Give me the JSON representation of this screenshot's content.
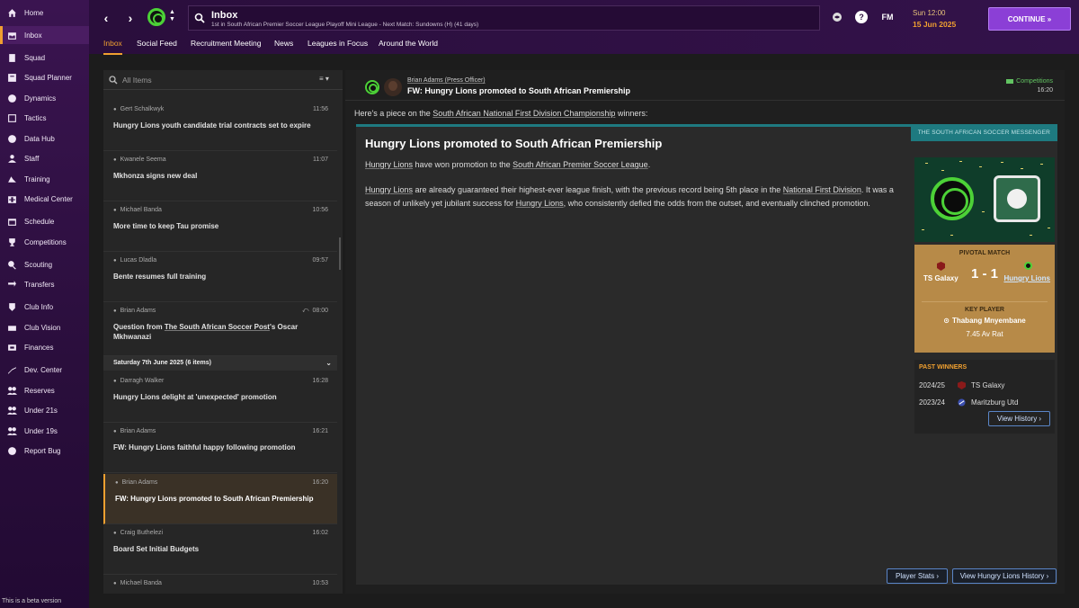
{
  "sidebar": {
    "items": [
      {
        "label": "Home",
        "icon": "home-icon"
      },
      {
        "label": "Inbox",
        "icon": "inbox-icon"
      },
      {
        "label": "Squad",
        "icon": "squad-icon"
      },
      {
        "label": "Squad Planner",
        "icon": "squad-planner-icon"
      },
      {
        "label": "Dynamics",
        "icon": "dynamics-icon"
      },
      {
        "label": "Tactics",
        "icon": "tactics-icon"
      },
      {
        "label": "Data Hub",
        "icon": "data-hub-icon"
      },
      {
        "label": "Staff",
        "icon": "staff-icon"
      },
      {
        "label": "Training",
        "icon": "training-icon"
      },
      {
        "label": "Medical Center",
        "icon": "medical-icon"
      },
      {
        "label": "Schedule",
        "icon": "schedule-icon"
      },
      {
        "label": "Competitions",
        "icon": "trophy-icon"
      },
      {
        "label": "Scouting",
        "icon": "scouting-icon"
      },
      {
        "label": "Transfers",
        "icon": "transfers-icon"
      },
      {
        "label": "Club Info",
        "icon": "club-info-icon"
      },
      {
        "label": "Club Vision",
        "icon": "club-vision-icon"
      },
      {
        "label": "Finances",
        "icon": "finances-icon"
      },
      {
        "label": "Dev. Center",
        "icon": "dev-center-icon"
      },
      {
        "label": "Reserves",
        "icon": "reserves-icon"
      },
      {
        "label": "Under 21s",
        "icon": "under21-icon"
      },
      {
        "label": "Under 19s",
        "icon": "under19-icon"
      },
      {
        "label": "Report Bug",
        "icon": "report-bug-icon"
      }
    ],
    "beta_note": "This is a beta version"
  },
  "topbar": {
    "title": "Inbox",
    "subtitle": "1st in South African Premier Soccer League Playoff Mini League - Next Match: Sundowns (H) (41 days)",
    "fm_label": "FM",
    "time": "Sun 12:00",
    "date": "15 Jun 2025",
    "continue_label": "CONTINUE  »",
    "accent": "#f0a030"
  },
  "tabs": [
    "Inbox",
    "Social Feed",
    "Recruitment Meeting",
    "News",
    "Leagues in Focus",
    "Around the World"
  ],
  "list": {
    "filter_label": "All Items",
    "view_toggle": "≡ ▾",
    "date_group": "Saturday 7th June 2025 (6 items)",
    "messages": [
      {
        "sender": "Gert Schalkwyk",
        "time": "11:56",
        "subject": "Hungry Lions youth candidate trial contracts set to expire"
      },
      {
        "sender": "Kwanele Seema",
        "time": "11:07",
        "subject": "Mkhonza signs new deal"
      },
      {
        "sender": "Michael Banda",
        "time": "10:56",
        "subject": "More time to keep Tau promise"
      },
      {
        "sender": "Lucas Dladla",
        "time": "09:57",
        "subject": "Bente resumes full training"
      },
      {
        "sender": "Brian Adams",
        "time": "08:00",
        "subject_pre": "Question from ",
        "subject_link": "The South African Soccer Post",
        "subject_post": "'s Oscar Mkhwanazi"
      },
      {
        "sender": "Darragh Walker",
        "time": "16:28",
        "subject": "Hungry Lions delight at 'unexpected' promotion"
      },
      {
        "sender": "Brian Adams",
        "time": "16:21",
        "subject": "FW: Hungry Lions faithful happy following promotion"
      },
      {
        "sender": "Brian Adams",
        "time": "16:20",
        "subject": "FW: Hungry Lions promoted to South African Premiership"
      },
      {
        "sender": "Craig Buthelezi",
        "time": "16:02",
        "subject": "Board Set Initial Budgets"
      },
      {
        "sender": "Michael Banda",
        "time": "10:53",
        "subject": ""
      }
    ]
  },
  "article": {
    "sender": "Brian Adams  (Press Officer)",
    "subject": "FW: Hungry Lions promoted to South African Premiership",
    "category": "Competitions",
    "time": "16:20",
    "intro_pre": "Here's a piece on the ",
    "intro_link": "South African National First Division Championship",
    "intro_post": " winners:",
    "masthead": "THE SOUTH AFRICAN SOCCER MESSENGER",
    "headline": "Hungry Lions promoted to South African Premiership",
    "p1": {
      "a": "Hungry Lions",
      "b": " have won promotion to the ",
      "c": "South African Premier Soccer League",
      "d": "."
    },
    "p2": {
      "a": "Hungry Lions",
      "b": " are already guaranteed their highest-ever league finish, with the previous record being 5th place in the ",
      "c": "National First Division",
      "d": ". It was a season of unlikely yet jubilant success for ",
      "e": "Hungry Lions",
      "f": ", who consistently defied the odds from the outset, and eventually clinched promotion."
    }
  },
  "pivotal_match": {
    "label": "PIVOTAL MATCH",
    "home": "TS Galaxy",
    "score": "1 - 1",
    "away": "Hungry Lions",
    "key_player_label": "KEY PLAYER",
    "key_player": "Thabang Mnyembane",
    "rating": "7.45 Av Rat"
  },
  "past_winners": {
    "title": "PAST WINNERS",
    "rows": [
      {
        "season": "2024/25",
        "team": "TS Galaxy"
      },
      {
        "season": "2023/24",
        "team": "Maritzburg Utd"
      }
    ],
    "view_history_label": "View History  ›"
  },
  "footer": {
    "player_stats_label": "Player Stats  ›",
    "club_history_label": "View Hungry Lions History  ›"
  }
}
